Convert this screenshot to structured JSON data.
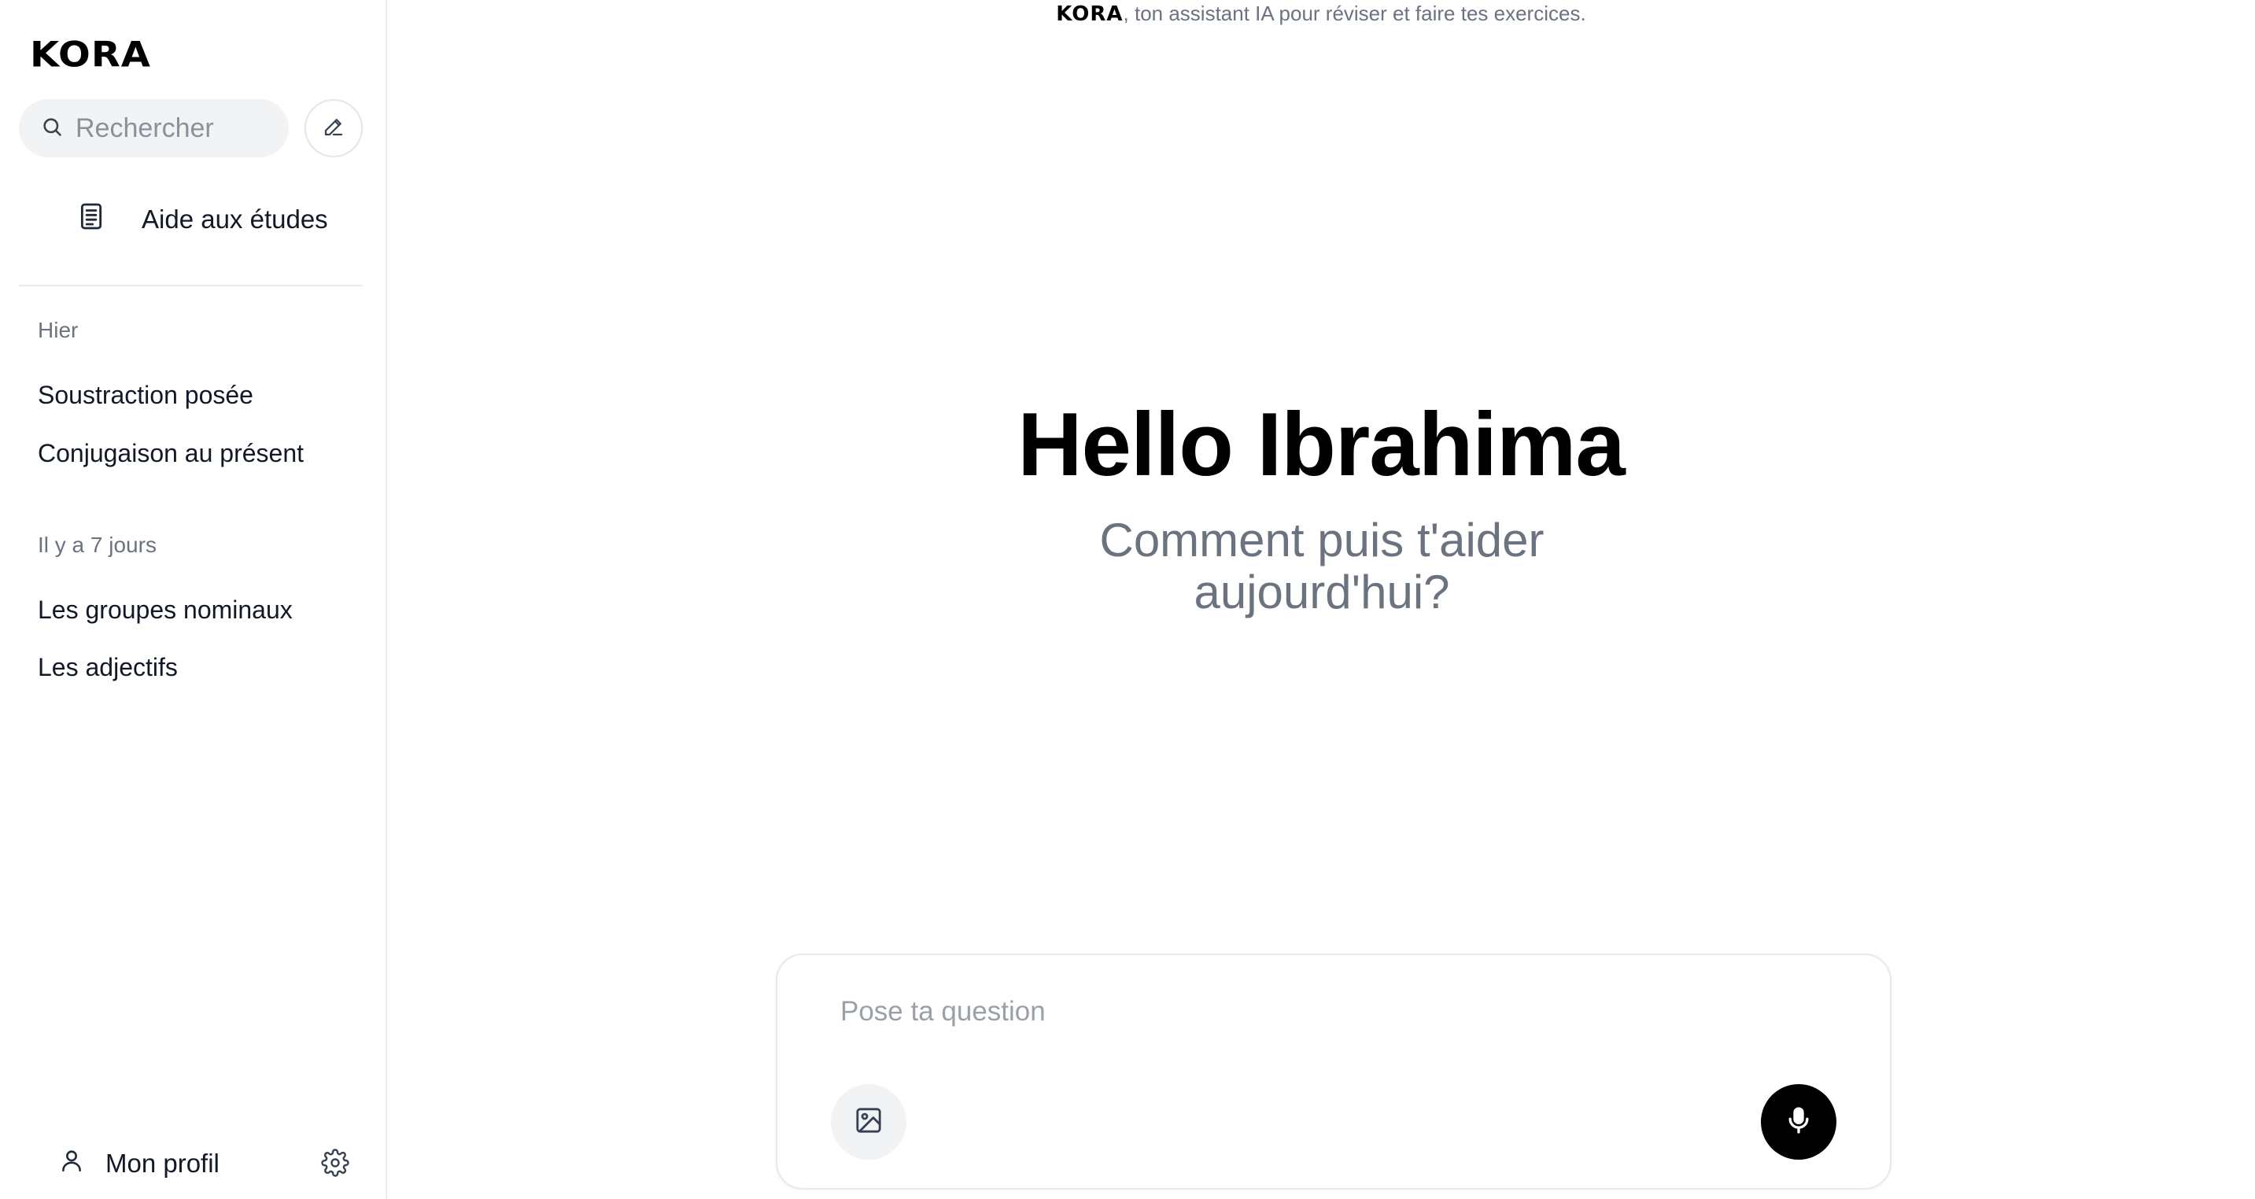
{
  "sidebar": {
    "logo": "KORA",
    "search_placeholder": "Rechercher",
    "study_label": "Aide aux études",
    "groups": [
      {
        "label": "Hier",
        "items": [
          "Soustraction posée",
          "Conjugaison au présent"
        ]
      },
      {
        "label": "Il y a 7 jours",
        "items": [
          "Les groupes nominaux",
          "Les adjectifs"
        ]
      }
    ],
    "profile_label": "Mon profil"
  },
  "header": {
    "brand": "KORA",
    "tagline_rest": ", ton assistant IA pour réviser et faire tes exercices."
  },
  "main": {
    "greeting": "Hello Ibrahima",
    "subtitle": "Comment puis t'aider aujourd'hui?"
  },
  "composer": {
    "placeholder": "Pose ta question"
  },
  "icons": {
    "search": "search-icon",
    "new_chat": "pencil-icon",
    "study": "document-icon",
    "profile": "user-icon",
    "settings": "gear-icon",
    "image": "image-icon",
    "mic": "microphone-icon"
  },
  "colors": {
    "accent": "#000000",
    "muted_text": "#6b7280",
    "surface": "#f2f3f5"
  }
}
